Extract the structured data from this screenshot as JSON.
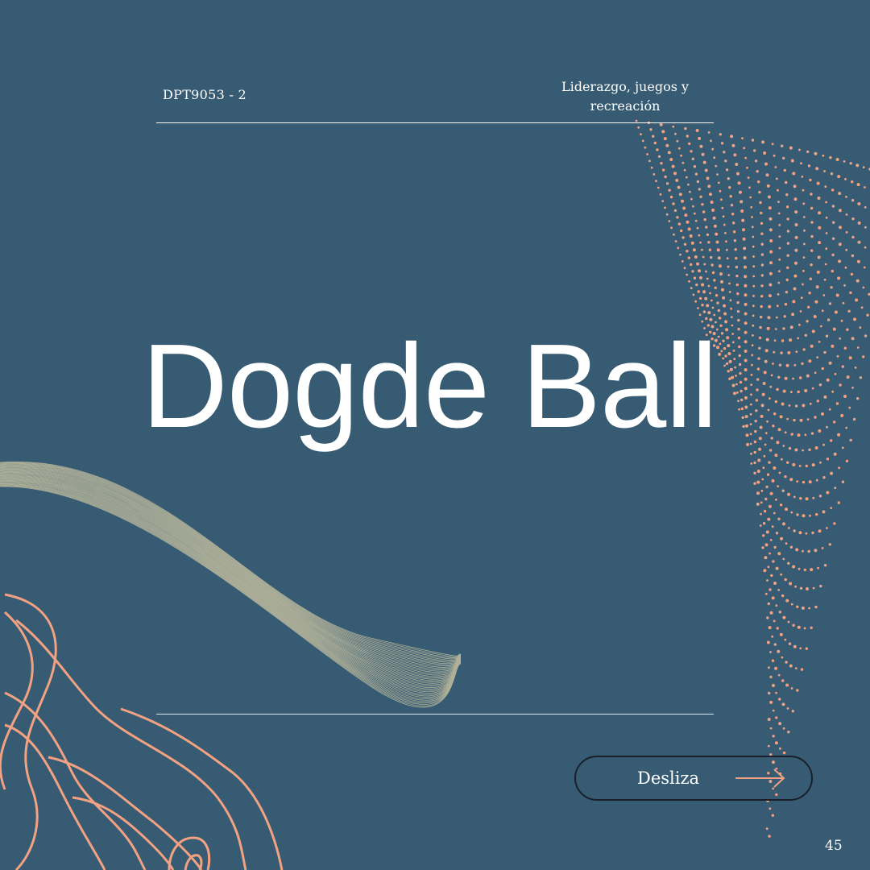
{
  "header": {
    "course_code": "DPT9053 - 2",
    "course_name_line1": "Liderazgo, juegos y",
    "course_name_line2": "recreación"
  },
  "main": {
    "title": "Dogde Ball"
  },
  "footer": {
    "swipe_label": "Desliza",
    "page_number": "45"
  },
  "colors": {
    "background": "#365b72",
    "accent": "#f2a283",
    "lines": "#d8cda6",
    "text": "#ffffff"
  },
  "icons": {
    "swipe_arrow": "arrow-right-icon"
  }
}
